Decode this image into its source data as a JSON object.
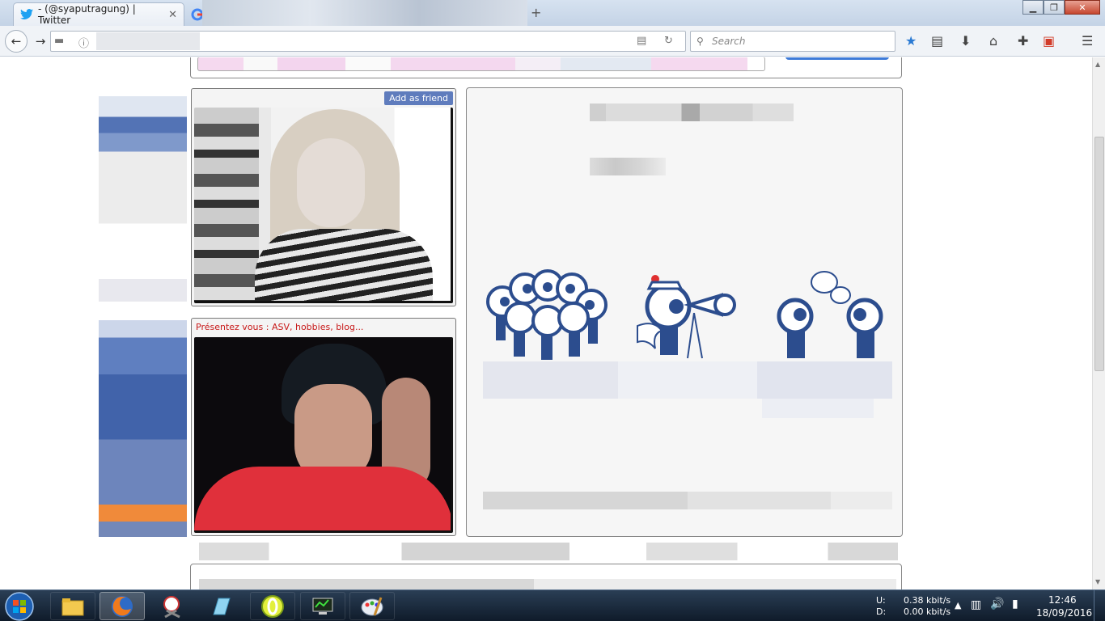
{
  "browser": {
    "tabs": [
      {
        "title": "- (@syaputragung) | Twitter",
        "icon": "twitter-icon",
        "active": true
      },
      {
        "title": "",
        "icon": "google-icon",
        "active": false
      }
    ],
    "search_placeholder": "Search",
    "new_tab_symbol": "+"
  },
  "chat": {
    "add_friend_label": "Add as friend",
    "intro_prompt": "Présentez vous : ASV, hobbies, blog..."
  },
  "colors": {
    "accent_blue": "#2c4d8e",
    "prompt_red": "#c81a1a",
    "taskbar_dark": "#0f1b2a"
  },
  "tray": {
    "upload_label": "U:",
    "download_label": "D:",
    "upload_speed": "0.38 kbit/s",
    "download_speed": "0.00 kbit/s",
    "time": "12:46",
    "date": "18/09/2016"
  },
  "taskbar_apps": [
    "start-orb",
    "file-explorer-icon",
    "firefox-icon",
    "snipping-tool-icon",
    "notepad-icon",
    "opera-icon",
    "network-monitor-icon",
    "paint-icon"
  ]
}
